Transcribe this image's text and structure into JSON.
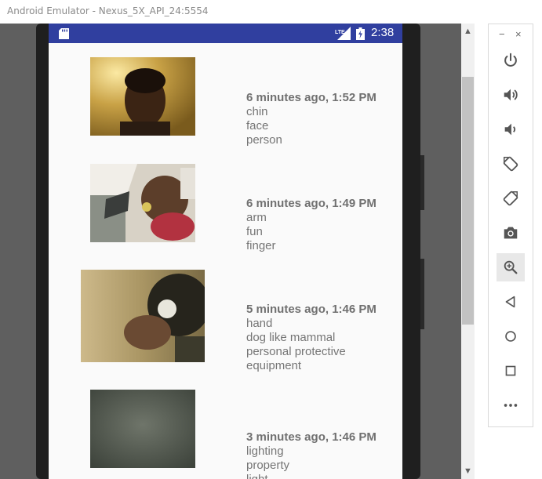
{
  "window": {
    "title": "Android Emulator - Nexus_5X_API_24:5554"
  },
  "statusbar": {
    "time": "2:38",
    "network": "LTE"
  },
  "items": [
    {
      "time": "6 minutes ago, 1:52 PM",
      "labels": [
        "chin",
        "face",
        "person"
      ]
    },
    {
      "time": "6 minutes ago, 1:49 PM",
      "labels": [
        "arm",
        "fun",
        "finger"
      ]
    },
    {
      "time": "5 minutes ago, 1:46 PM",
      "labels": [
        "hand",
        "dog like mammal",
        "personal protective",
        "equipment"
      ]
    },
    {
      "time": "3 minutes ago, 1:46 PM",
      "labels": [
        "lighting",
        "property",
        "light"
      ]
    }
  ],
  "toolbar": {
    "minimize": "−",
    "close": "×",
    "buttons": [
      "power-icon",
      "volume-up-icon",
      "volume-down-icon",
      "rotate-left-icon",
      "rotate-right-icon",
      "camera-icon",
      "zoom-icon",
      "back-icon",
      "home-icon",
      "overview-icon",
      "more-icon"
    ]
  },
  "colors": {
    "statusbar": "#303f9f",
    "screen_bg": "#fafafa",
    "text": "#757575"
  }
}
